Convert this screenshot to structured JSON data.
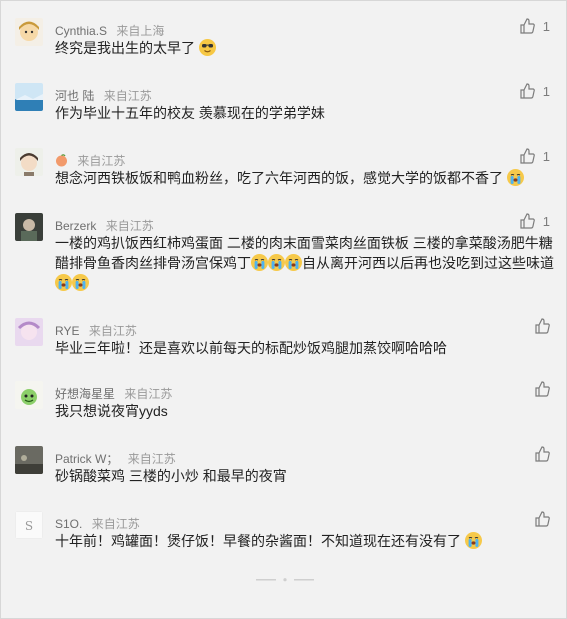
{
  "comments": [
    {
      "name": "Cynthia.S",
      "location": "来自上海",
      "text": "终究是我出生的太早了",
      "likes": "1",
      "emoji": "cool",
      "avatar": "cynthia"
    },
    {
      "name": "河也  陆",
      "location": "来自江苏",
      "text": "作为毕业十五年的校友 羡慕现在的学弟学妹",
      "likes": "1",
      "emoji": "",
      "avatar": "sky"
    },
    {
      "name": "",
      "location": "来自江苏",
      "text": "想念河西铁板饭和鸭血粉丝，吃了六年河西的饭，感觉大学的饭都不香了",
      "likes": "1",
      "emoji": "cry",
      "avatar": "girl"
    },
    {
      "name": "Berzerk",
      "location": "来自江苏",
      "text": "一楼的鸡扒饭西红柿鸡蛋面 二楼的肉末面雪菜肉丝面铁板 三楼的拿菜酸汤肥牛糖醋排骨鱼香肉丝排骨汤宫保鸡丁",
      "text2": "自从离开河西以后再也没吃到过这些味道",
      "likes": "1",
      "emoji": "cry",
      "avatar": "berzerk"
    },
    {
      "name": "RYE",
      "location": "来自江苏",
      "text": "毕业三年啦！还是喜欢以前每天的标配炒饭鸡腿加蒸饺啊哈哈哈",
      "likes": "",
      "emoji": "",
      "avatar": "rye"
    },
    {
      "name": "好想海星星",
      "location": "来自江苏",
      "text": "我只想说夜宵yyds",
      "likes": "",
      "emoji": "",
      "avatar": "star"
    },
    {
      "name": "Patrick W；",
      "location": "来自江苏",
      "text": "砂锅酸菜鸡 三楼的小炒 和最早的夜宵",
      "likes": "",
      "emoji": "",
      "avatar": "patrick"
    },
    {
      "name": "S1O.",
      "location": "来自江苏",
      "text": "十年前！鸡罐面！煲仔饭！早餐的杂酱面！不知道现在还有没有了",
      "likes": "",
      "emoji": "cry",
      "avatar": "s1o"
    }
  ],
  "icons": {
    "like": "thumbs-up-icon",
    "cry": "crying-emoji-icon",
    "cool": "sunglasses-emoji-icon"
  },
  "colors": {
    "background": "#f2f2f2",
    "text": "#222222",
    "meta": "#8a8a8a"
  }
}
